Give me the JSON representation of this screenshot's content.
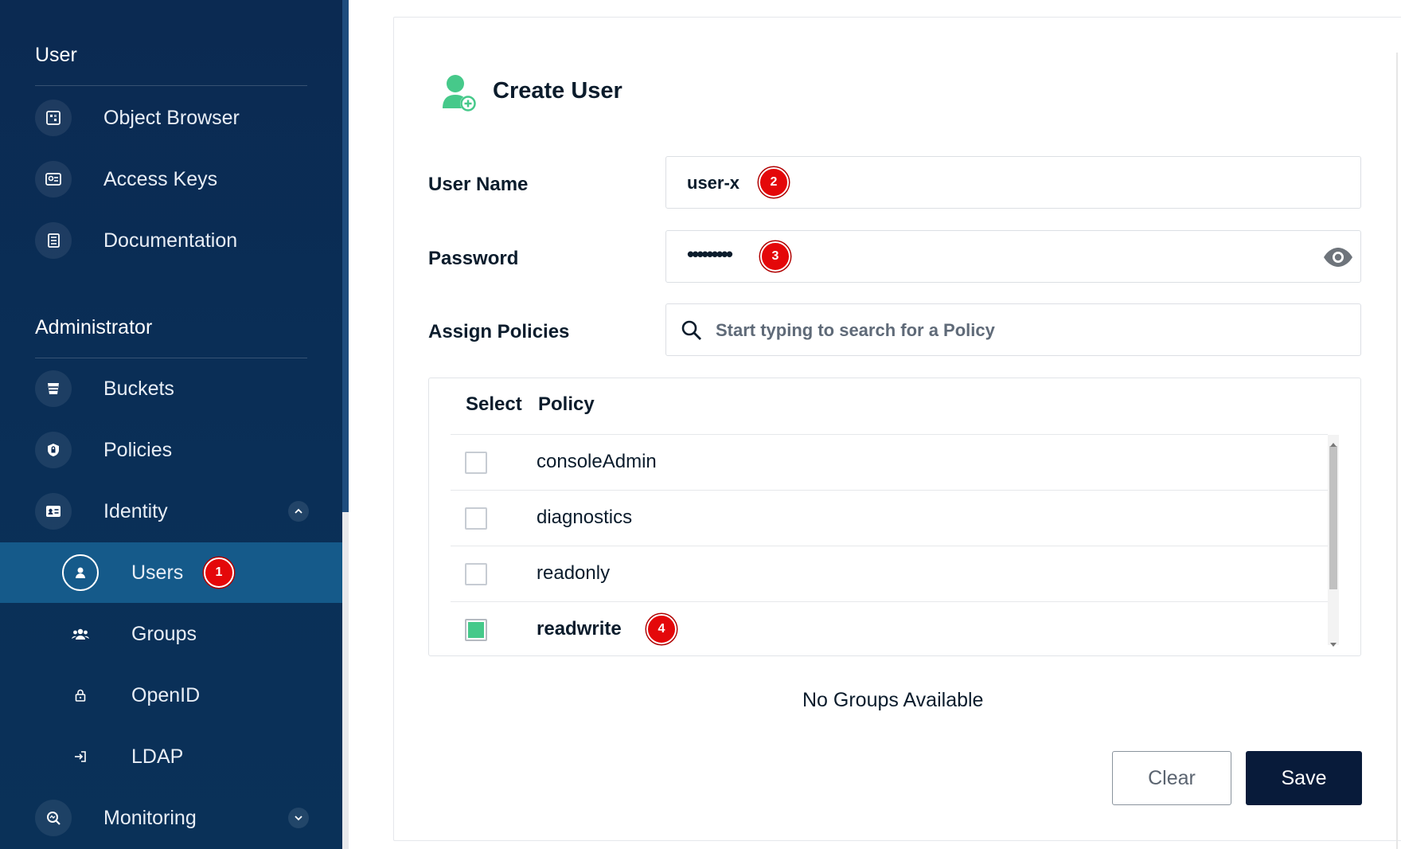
{
  "sidebar": {
    "user_section_title": "User",
    "admin_section_title": "Administrator",
    "items": [
      {
        "label": "Object Browser",
        "icon": "object-browser-icon"
      },
      {
        "label": "Access Keys",
        "icon": "access-keys-icon"
      },
      {
        "label": "Documentation",
        "icon": "documentation-icon"
      },
      {
        "label": "Buckets",
        "icon": "buckets-icon"
      },
      {
        "label": "Policies",
        "icon": "policies-icon"
      },
      {
        "label": "Identity",
        "icon": "identity-icon",
        "expanded": true
      },
      {
        "label": "Users",
        "icon": "user-icon",
        "active": true
      },
      {
        "label": "Groups",
        "icon": "groups-icon"
      },
      {
        "label": "OpenID",
        "icon": "lock-icon"
      },
      {
        "label": "LDAP",
        "icon": "login-icon"
      },
      {
        "label": "Monitoring",
        "icon": "monitoring-icon",
        "expanded": false
      }
    ]
  },
  "form": {
    "title": "Create User",
    "user_name_label": "User Name",
    "user_name_value": "user-x",
    "password_label": "Password",
    "password_value": "•••••••••",
    "assign_policies_label": "Assign Policies",
    "policy_search_placeholder": "Start typing to search for a Policy"
  },
  "policy_table": {
    "col_select": "Select",
    "col_policy": "Policy",
    "rows": [
      {
        "name": "consoleAdmin",
        "checked": false
      },
      {
        "name": "diagnostics",
        "checked": false
      },
      {
        "name": "readonly",
        "checked": false
      },
      {
        "name": "readwrite",
        "checked": true
      }
    ]
  },
  "groups_message": "No Groups Available",
  "buttons": {
    "clear": "Clear",
    "save": "Save"
  },
  "badges": {
    "b1": "1",
    "b2": "2",
    "b3": "3",
    "b4": "4"
  },
  "colors": {
    "sidebar_bg": "#0b2a52",
    "active_item": "#155a8a",
    "accent_green": "#46c98a",
    "save_bg": "#081b3a",
    "badge_red": "#e4080a"
  }
}
